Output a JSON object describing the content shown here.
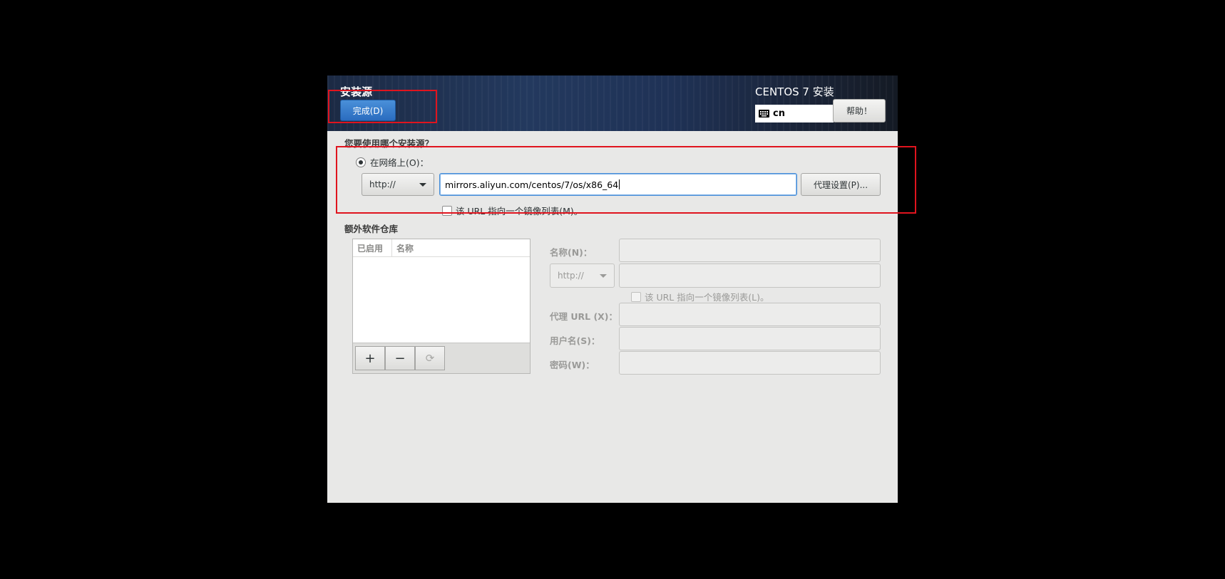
{
  "header": {
    "page_title": "安装源",
    "done_button": "完成(D)",
    "product_title": "CENTOS 7 安装",
    "keyboard_layout": "cn",
    "help_button": "帮助！"
  },
  "source": {
    "question": "您要使用哪个安装源？",
    "network_radio_label": "在网络上(O)：",
    "protocol": "http://",
    "url_value": "mirrors.aliyun.com/centos/7/os/x86_64",
    "proxy_button": "代理设置(P)...",
    "mirrorlist_checkbox": "该 URL 指向一个镜像列表(M)。"
  },
  "extra_repos": {
    "title": "额外软件仓库",
    "columns": [
      "已启用",
      "名称"
    ],
    "add_symbol": "+",
    "remove_symbol": "−",
    "refresh_symbol": "⟳"
  },
  "repo_form": {
    "name_label": "名称(N)：",
    "protocol": "http://",
    "mirrorlist_checkbox": "该 URL 指向一个镜像列表(L)。",
    "proxy_url_label": "代理 URL (X)：",
    "username_label": "用户名(S)：",
    "password_label": "密码(W)："
  },
  "colors": {
    "done_button": "#2a6cbf",
    "highlight_box": "#e0141e",
    "header_bg": "#1f3256"
  }
}
